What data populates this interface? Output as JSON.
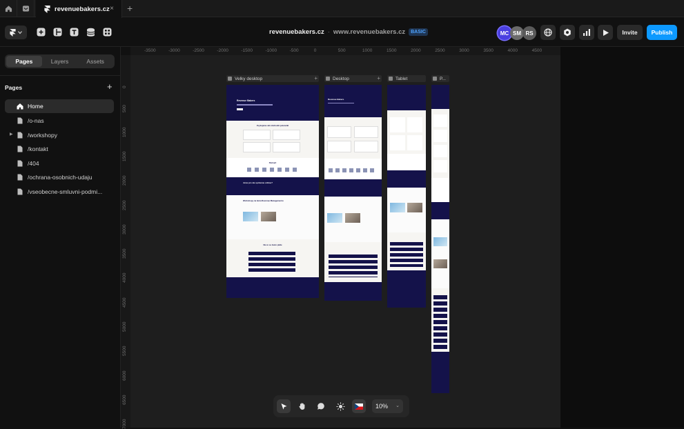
{
  "tabbar": {
    "active_tab": "revenuebakers.cz",
    "close_glyph": "×",
    "new_tab_glyph": "+"
  },
  "toolbar": {
    "project_name": "revenuebakers.cz",
    "separator": "·",
    "domain": "www.revenuebakers.cz",
    "plan_badge": "BASIC",
    "collaborators": [
      {
        "initials": "MC",
        "color": "#4a3fe0"
      },
      {
        "initials": "SM",
        "color": "#6b6b6b"
      },
      {
        "initials": "RS",
        "color": "#5a5a5a"
      }
    ],
    "invite_label": "Invite",
    "publish_label": "Publish",
    "accent_color": "#0d99ff"
  },
  "sidebar": {
    "tabs": [
      {
        "label": "Pages",
        "active": true
      },
      {
        "label": "Layers",
        "active": false
      },
      {
        "label": "Assets",
        "active": false
      }
    ],
    "pages_heading": "Pages",
    "add_glyph": "+",
    "pages": [
      {
        "label": "Home",
        "icon": "home-icon",
        "active": true
      },
      {
        "label": "/o-nas",
        "icon": "page-icon",
        "active": false
      },
      {
        "label": "/workshopy",
        "icon": "page-icon",
        "active": false,
        "expandable": true
      },
      {
        "label": "/kontakt",
        "icon": "page-icon",
        "active": false
      },
      {
        "label": "/404",
        "icon": "page-icon",
        "active": false
      },
      {
        "label": "/ochrana-osobnich-udaju",
        "icon": "page-icon",
        "active": false
      },
      {
        "label": "/vseobecne-smluvni-podmi...",
        "icon": "page-icon",
        "active": false
      }
    ]
  },
  "canvas": {
    "ruler_top": [
      "-3500",
      "-3000",
      "-2500",
      "-2000",
      "-1500",
      "-1000",
      "-500",
      "0",
      "500",
      "1000",
      "1500",
      "2000",
      "2500",
      "3000",
      "3500",
      "4000",
      "4500"
    ],
    "ruler_left": [
      "0",
      "500",
      "1000",
      "1500",
      "2000",
      "2500",
      "3000",
      "3500",
      "4000",
      "4500",
      "5000",
      "5500",
      "6000",
      "6500",
      "7000"
    ],
    "frames": [
      {
        "label": "Velky desktop"
      },
      {
        "label": "Desktop"
      },
      {
        "label": "Tablet"
      },
      {
        "label": "P..."
      }
    ],
    "site_brand_color": "#14124a",
    "preview_texts": {
      "hero_title": "Revenue Bakers",
      "services_title": "Zvyšujeme váš obchodní potenciál",
      "partners_title": "Partneři",
      "cta_title": "Jsme pro vás správnou volbou?",
      "workshops_title": "Workshopy na téma Revenue Managementu",
      "faq_title": "Na co se často ptáte"
    }
  },
  "bottom_toolbar": {
    "zoom_level": "10%",
    "tools": [
      "cursor-icon",
      "hand-icon",
      "comment-icon",
      "sun-icon",
      "flag-icon"
    ]
  }
}
